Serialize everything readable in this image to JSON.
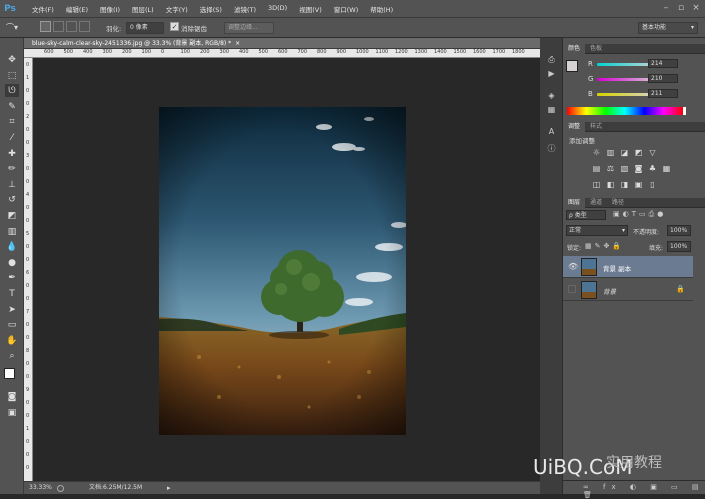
{
  "app": {
    "logo": "Ps"
  },
  "menu": [
    "文件(F)",
    "编辑(E)",
    "图像(I)",
    "图层(L)",
    "文字(Y)",
    "选择(S)",
    "滤镜(T)",
    "3D(D)",
    "视图(V)",
    "窗口(W)",
    "帮助(H)"
  ],
  "options": {
    "feather_label": "羽化:",
    "feather_value": "0 像素",
    "antialias_label": "消除锯齿",
    "refine_edge": "调整边缘...",
    "workspace": "基本功能"
  },
  "document": {
    "tab_title": "blue-sky-calm-clear-sky-2451336.jpg @ 33.3% (背景 副本, RGB/8) *",
    "close": "×",
    "zoom": "33.33%",
    "doc_size": "文档:6.25M/12.5M",
    "ruler_top": [
      "600",
      "500",
      "400",
      "300",
      "200",
      "100",
      "0",
      "100",
      "200",
      "300",
      "400",
      "500",
      "600",
      "700",
      "800",
      "900",
      "1000",
      "1100",
      "1200",
      "1300",
      "1400",
      "1500",
      "1600",
      "1700",
      "1800"
    ],
    "ruler_left": [
      "0",
      "1",
      "0",
      "0",
      "2",
      "0",
      "0",
      "3",
      "0",
      "0",
      "4",
      "0",
      "0",
      "5",
      "0",
      "0",
      "6",
      "0",
      "0",
      "7",
      "0",
      "0",
      "8",
      "0",
      "0",
      "9",
      "0",
      "0",
      "1",
      "0",
      "0",
      "0"
    ]
  },
  "color_panel": {
    "tabs": [
      "颜色",
      "色板"
    ],
    "r_label": "R",
    "r_value": "214",
    "g_label": "G",
    "g_value": "210",
    "b_label": "B",
    "b_value": "211"
  },
  "adjust_panel": {
    "tabs": [
      "调整",
      "样式"
    ],
    "title": "添加调整"
  },
  "layers_panel": {
    "tabs": [
      "图层",
      "通道",
      "路径"
    ],
    "filter": "ρ 类型",
    "blend_mode": "正常",
    "opacity_label": "不透明度:",
    "opacity_value": "100%",
    "lock_label": "锁定:",
    "fill_label": "填充:",
    "fill_value": "100%",
    "layers": [
      {
        "name": "背景 副本"
      },
      {
        "name": "背景"
      }
    ]
  },
  "watermark": "UiBQ.CoM",
  "watermark_cn": "实用教程",
  "colors": {
    "menu_bg": "#535353",
    "canvas_bg": "#282828",
    "selected_layer": "#6b7b92",
    "accent": "#4fa3e0"
  }
}
